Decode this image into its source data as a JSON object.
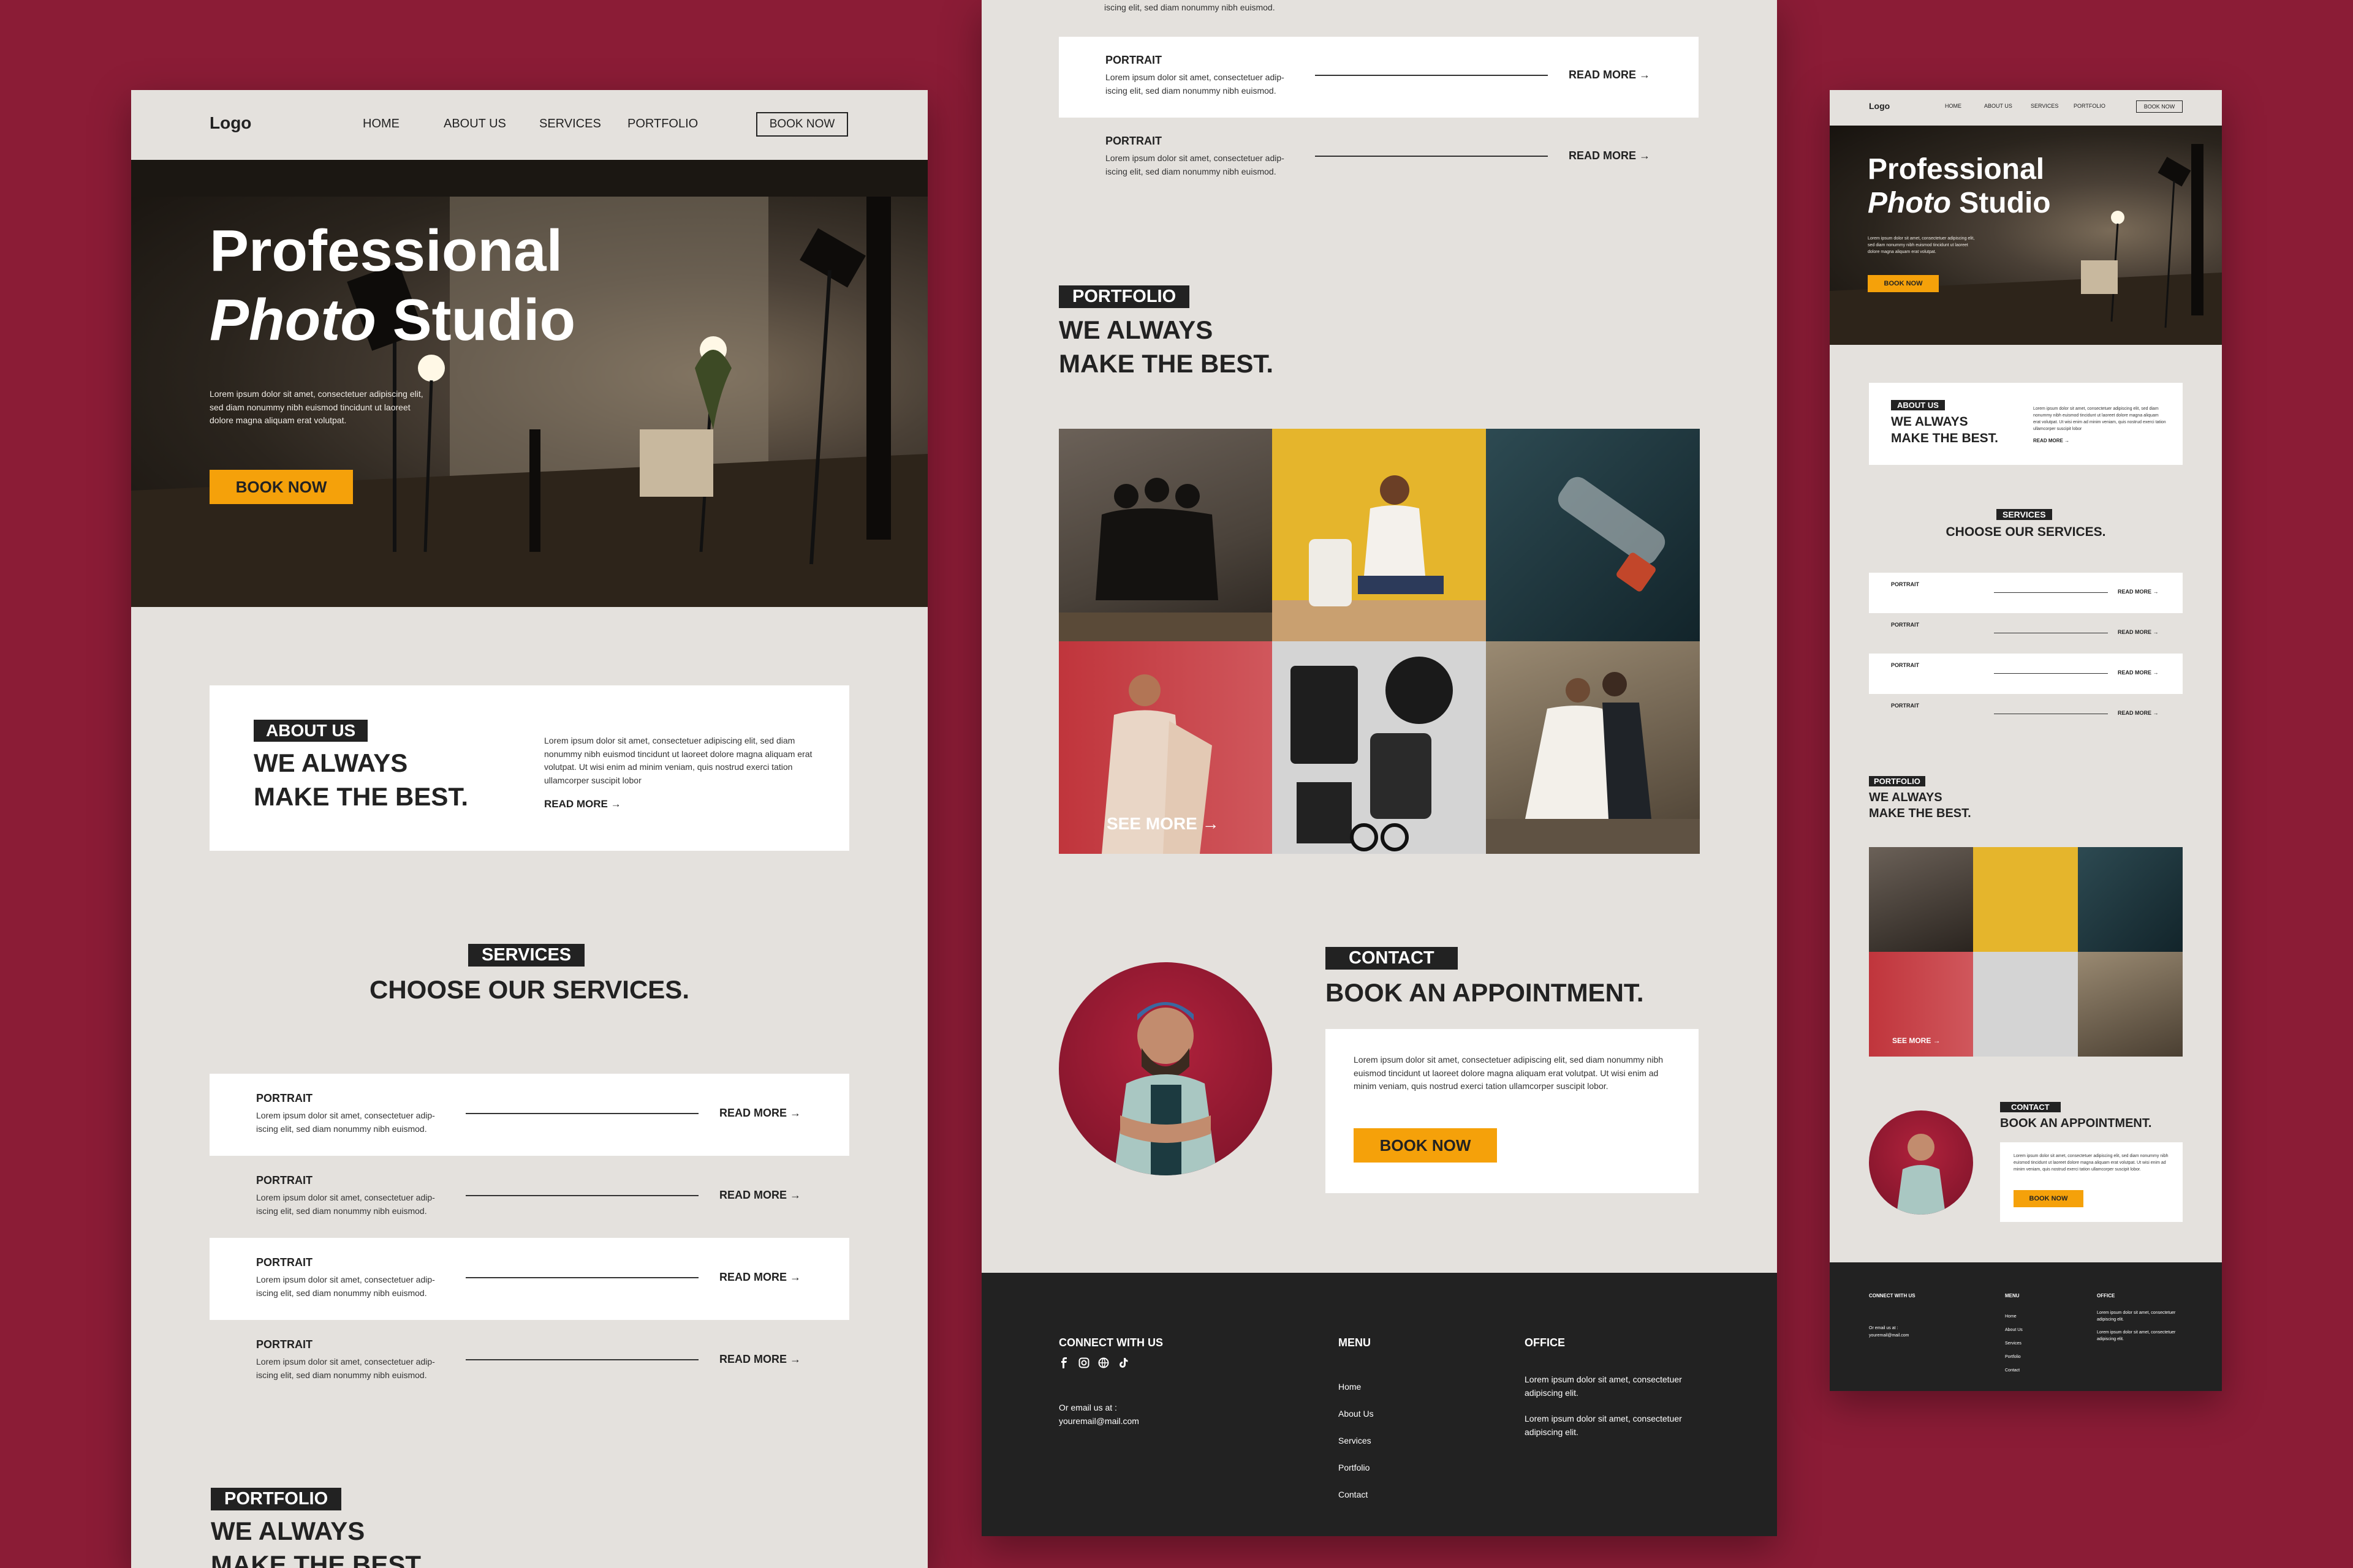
{
  "colors": {
    "background": "#8b1c36",
    "page": "#e4e1dd",
    "accent": "#f5a10a",
    "dark": "#222222",
    "card": "#ffffff"
  },
  "nav": {
    "logo": "Logo",
    "home": "HOME",
    "about": "ABOUT US",
    "services": "SERVICES",
    "portfolio": "PORTFOLIO",
    "book": "BOOK NOW"
  },
  "hero": {
    "title_line1": "Professional",
    "title_line2_italic": "Photo",
    "title_line2_rest": " Studio",
    "text": "Lorem ipsum dolor sit amet, consectetuer adipiscing elit, sed diam nonummy nibh euismod tincidunt ut laoreet dolore magna aliquam erat volutpat.",
    "button": "BOOK NOW"
  },
  "about": {
    "tag": "ABOUT US",
    "heading_line1": "WE ALWAYS",
    "heading_line2": "MAKE THE BEST.",
    "text": "Lorem ipsum dolor sit amet, consectetuer adipiscing elit, sed diam nonummy nibh euismod tincidunt ut laoreet dolore magna aliquam erat volutpat. Ut wisi enim ad minim veniam, quis nostrud exerci tation ullamcorper suscipit lobor",
    "read_more": "READ MORE →"
  },
  "services": {
    "tag": "SERVICES",
    "heading": "CHOOSE OUR SERVICES.",
    "items": [
      {
        "title": "PORTRAIT",
        "text_line1": "Lorem ipsum dolor sit amet, consectetuer adip-",
        "text_line2": "iscing elit, sed diam nonummy nibh euismod.",
        "link": "READ MORE →"
      },
      {
        "title": "PORTRAIT",
        "text_line1": "Lorem ipsum dolor sit amet, consectetuer adip-",
        "text_line2": "iscing elit, sed diam nonummy nibh euismod.",
        "link": "READ MORE →"
      },
      {
        "title": "PORTRAIT",
        "text_line1": "Lorem ipsum dolor sit amet, consectetuer adip-",
        "text_line2": "iscing elit, sed diam nonummy nibh euismod.",
        "link": "READ MORE →"
      },
      {
        "title": "PORTRAIT",
        "text_line1": "Lorem ipsum dolor sit amet, consectetuer adip-",
        "text_line2": "iscing elit, sed diam nonummy nibh euismod.",
        "link": "READ MORE →"
      }
    ]
  },
  "portfolio": {
    "tag": "PORTFOLIO",
    "heading_line1": "WE ALWAYS",
    "heading_line2": "MAKE THE BEST.",
    "see_more": "SEE MORE →"
  },
  "contact": {
    "tag": "CONTACT",
    "heading": "BOOK AN APPOINTMENT.",
    "text": "Lorem ipsum dolor sit amet, consectetuer adipiscing elit, sed diam nonummy nibh euismod tincidunt ut laoreet dolore magna aliquam erat volutpat. Ut wisi enim ad minim veniam, quis nostrud exerci tation ullamcorper suscipit lobor.",
    "button": "BOOK NOW"
  },
  "footer": {
    "connect_title": "CONNECT WITH US",
    "email_label": "Or email us at :",
    "email": "youremail@mail.com",
    "menu_title": "MENU",
    "menu": [
      "Home",
      "About Us",
      "Services",
      "Portfolio",
      "Contact"
    ],
    "office_title": "OFFICE",
    "office_line1": "Lorem ipsum dolor sit amet, consectetuer adipiscing elit.",
    "office_line2": "Lorem ipsum dolor sit amet, consectetuer adipiscing elit.",
    "social_icons": [
      "facebook-icon",
      "instagram-icon",
      "globe-icon",
      "tiktok-icon"
    ]
  },
  "top_fragment": {
    "text": "iscing elit, sed diam nonummy nibh euismod."
  }
}
